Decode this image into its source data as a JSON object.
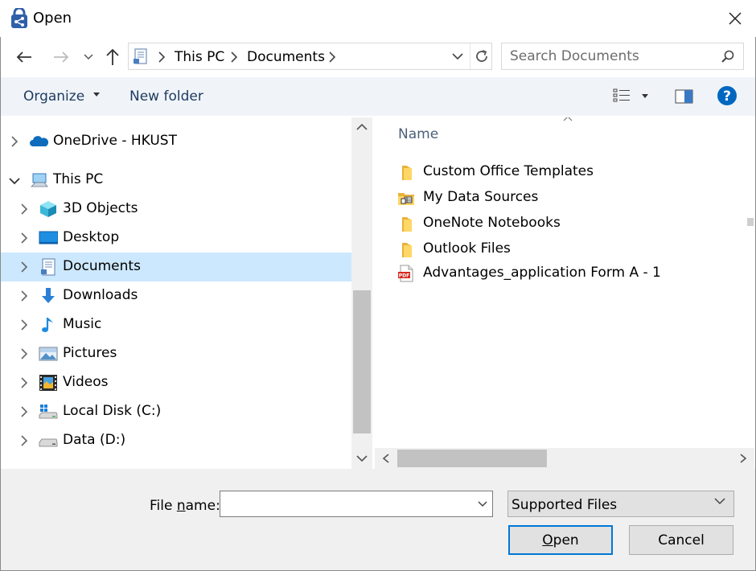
{
  "window": {
    "title": "Open",
    "close_icon": "close-icon",
    "app_icon": "open-dialog-icon"
  },
  "address_bar": {
    "breadcrumbs": [
      "This PC",
      "Documents"
    ],
    "location_icon": "documents-icon"
  },
  "search": {
    "placeholder": "Search Documents",
    "value": ""
  },
  "toolbar": {
    "organize_label": "Organize",
    "new_folder_label": "New folder"
  },
  "nav_pane": {
    "items": [
      {
        "label": "OneDrive - HKUST",
        "icon": "onedrive-cloud-icon",
        "level": 0,
        "expanded": false,
        "selected": false
      },
      {
        "label": "This PC",
        "icon": "this-pc-icon",
        "level": 0,
        "expanded": true,
        "selected": false
      },
      {
        "label": "3D Objects",
        "icon": "3d-objects-icon",
        "level": 1,
        "expanded": false,
        "selected": false
      },
      {
        "label": "Desktop",
        "icon": "desktop-icon",
        "level": 1,
        "expanded": false,
        "selected": false
      },
      {
        "label": "Documents",
        "icon": "documents-icon",
        "level": 1,
        "expanded": false,
        "selected": true
      },
      {
        "label": "Downloads",
        "icon": "downloads-icon",
        "level": 1,
        "expanded": false,
        "selected": false
      },
      {
        "label": "Music",
        "icon": "music-icon",
        "level": 1,
        "expanded": false,
        "selected": false
      },
      {
        "label": "Pictures",
        "icon": "pictures-icon",
        "level": 1,
        "expanded": false,
        "selected": false
      },
      {
        "label": "Videos",
        "icon": "videos-icon",
        "level": 1,
        "expanded": false,
        "selected": false
      },
      {
        "label": "Local Disk (C:)",
        "icon": "local-disk-icon",
        "level": 1,
        "expanded": false,
        "selected": false
      },
      {
        "label": "Data (D:)",
        "icon": "drive-icon",
        "level": 1,
        "expanded": false,
        "selected": false
      }
    ]
  },
  "content": {
    "column_header": "Name",
    "files": [
      {
        "label": "Custom Office Templates",
        "icon": "folder-icon"
      },
      {
        "label": "My Data Sources",
        "icon": "data-sources-folder-icon"
      },
      {
        "label": "OneNote Notebooks",
        "icon": "folder-icon"
      },
      {
        "label": "Outlook Files",
        "icon": "folder-icon"
      },
      {
        "label": "Advantages_application Form A - 1",
        "icon": "pdf-file-icon"
      }
    ]
  },
  "bottom": {
    "file_name_label_prefix": "File ",
    "file_name_label_accel": "n",
    "file_name_label_suffix": "ame:",
    "file_name_value": "",
    "filter_value": "Supported Files",
    "open_accel": "O",
    "open_rest": "pen",
    "cancel_label": "Cancel"
  },
  "colors": {
    "selection": "#cce8ff",
    "toolbar_bg": "#f0f4f9",
    "primary_border": "#0078d7",
    "help_blue": "#0067c0"
  }
}
